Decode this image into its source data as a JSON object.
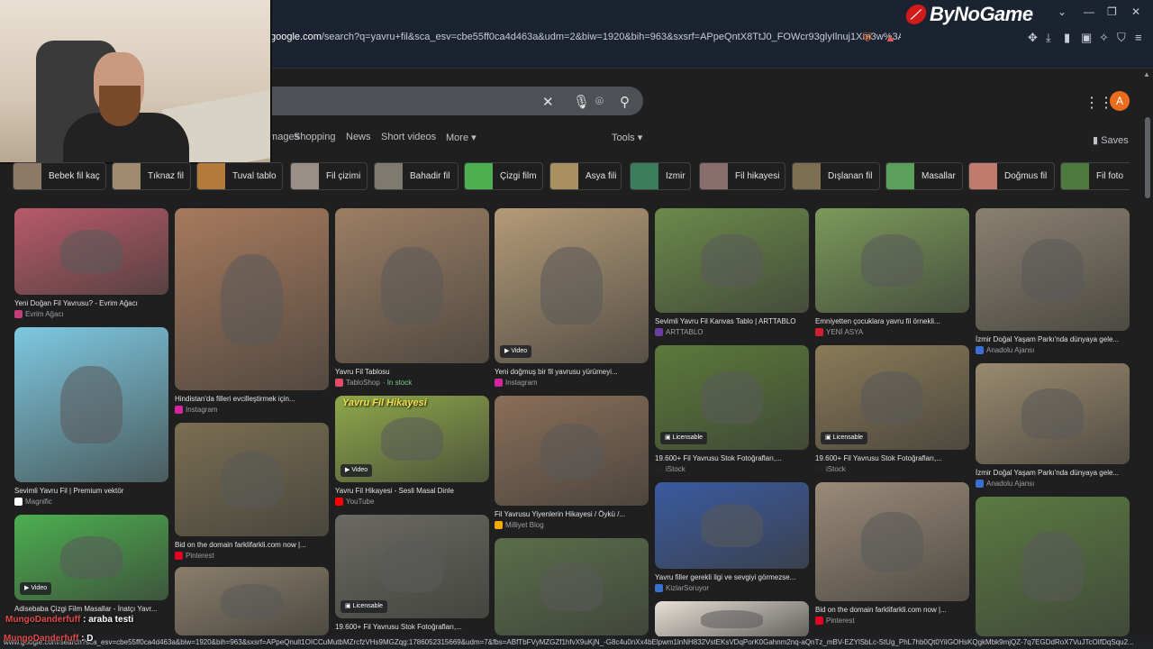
{
  "browser": {
    "url_domain": "google.com",
    "url_rest": "/search?q=yavru+fil&sca_esv=cbe55ff0ca4d463a&udm=2&biw=1920&bih=963&sxsrf=APpeQntX8TtJ0_FOWcr93glyIlnuj1Xm3w%3A1786052...",
    "status_url": "www.google.com/search?sca_esv=cbe55ff0ca4d463a&biw=1920&bih=963&sxsrf=APpeQnult1OICCuMutbMZrcfzVHs9MGZqg:1786052315669&udm=7&fbs=ABfTbFVyMZGZf1hfvX9uKjN_-G8c4u0nXx4bElpwm1lnNH832VstEKsVDqPorK0Gahnm2nq-aQnTz_mBV-EZYlSbLc-StUg_PhL7hb0Qt0YiIGOHsKQgkMbk9mjQZ-7q7EGDdRoX7VuJTcOIfDqSqu2...",
    "brand": "ByNoGame"
  },
  "search": {
    "tabs": [
      "Images",
      "Shopping",
      "News",
      "Short videos",
      "More",
      "Tools"
    ],
    "saves_label": "Saves",
    "avatar_letter": "A"
  },
  "chips": [
    {
      "label": "Bebek fil kaç",
      "color": "#8c7a66"
    },
    {
      "label": "Tıknaz fil",
      "color": "#a08a70"
    },
    {
      "label": "Tuval tablo",
      "color": "#b47a3c"
    },
    {
      "label": "Fil çizimi",
      "color": "#9a8f86"
    },
    {
      "label": "Bahadir fil",
      "color": "#7e7a70"
    },
    {
      "label": "Çizgi film",
      "color": "#4caf50"
    },
    {
      "label": "Asya fili",
      "color": "#a89060"
    },
    {
      "label": "Izmir",
      "color": "#3b7d5a"
    },
    {
      "label": "Fil hikayesi",
      "color": "#8a6e6e"
    },
    {
      "label": "Dışlanan fil",
      "color": "#7e6e52"
    },
    {
      "label": "Masallar",
      "color": "#5aa05a"
    },
    {
      "label": "Doğmus fil",
      "color": "#c07a6e"
    },
    {
      "label": "Fil foto",
      "color": "#4f7a3e"
    }
  ],
  "results": [
    {
      "caption": "Yeni Doğan Fil Yavrusu? - Evrim Ağacı",
      "source": "Evrim Ağacı",
      "color": "#b85a6a",
      "fav": "#c43f7a"
    },
    {
      "caption": "Sevimli Yavru Fil | Premium vektör",
      "source": "Magnific",
      "color": "#7ec8e0",
      "fav": "#ffffff"
    },
    {
      "caption": "Adisebaba Çizgi Film Masallar - İnatçı Yavr...",
      "source": "",
      "color": "#4caf50",
      "fav": "#ff0000",
      "badge": "Video"
    },
    {
      "caption": "Hindistan'da filleri evcilleştirmek için...",
      "source": "Instagram",
      "color": "#a67a5e",
      "fav": "#d6249f"
    },
    {
      "caption": "Bid on the domain farklifarkli.com now |...",
      "source": "Pinterest",
      "color": "#7a6e52",
      "fav": "#e60023"
    },
    {
      "caption": "",
      "source": "",
      "color": "#8a7e6a",
      "fav": "#000000"
    },
    {
      "caption": "Yavru Fil Tablosu",
      "source": "TabloShop",
      "stock": "· In stock",
      "color": "#9c7e64",
      "fav": "#e24b6a"
    },
    {
      "caption": "Yavru Fil Hikayesi - Sesli Masal Dinle",
      "source": "YouTube",
      "color": "#8ea84a",
      "fav": "#ff0000",
      "badge": "Video",
      "title_overlay": "Yavru Fil Hikayesi"
    },
    {
      "caption": "19.600+ Fil Yavrusu Stok Fotoğrafları,...",
      "source": "",
      "color": "#6a6a62",
      "fav": "#000000",
      "badge": "Licensable"
    },
    {
      "caption": "Yeni doğmuş bir fil yavrusu yürümeyi...",
      "source": "Instagram",
      "color": "#b49a78",
      "fav": "#d6249f",
      "badge": "Video"
    },
    {
      "caption": "Fil Yavrusu Yiyenlerin Hikayesi / Öykü /...",
      "source": "Milliyet Blog",
      "color": "#8a6e58",
      "fav": "#f2a900"
    },
    {
      "caption": "",
      "source": "",
      "color": "#5a6e4a",
      "fav": "#000000"
    },
    {
      "caption": "Sevimli Yavru Fil Kanvas Tablo | ARTTABLO",
      "source": "ARTTABLO",
      "color": "#6a8a4a",
      "fav": "#6a3fa0"
    },
    {
      "caption": "19.600+ Fil Yavrusu Stok Fotoğrafları,...",
      "source": "iStock",
      "color": "#5a7a3a",
      "fav": "#222222",
      "badge": "Licensable"
    },
    {
      "caption": "Yavru filler gerekli ilgi ve sevgiyi görmezse...",
      "source": "KizlarSoruyor",
      "color": "#3a5aa0",
      "fav": "#3a6fd0"
    },
    {
      "caption": "",
      "source": "",
      "color": "#e8e0d8",
      "fav": "#000000"
    },
    {
      "caption": "Emniyetten çocuklara yavru fil örnekli...",
      "source": "YENİ ASYA",
      "color": "#7a9a5a",
      "fav": "#d01f2e"
    },
    {
      "caption": "19.600+ Fil Yavrusu Stok Fotoğrafları,...",
      "source": "iStock",
      "color": "#8a7a58",
      "fav": "#222222",
      "badge": "Licensable"
    },
    {
      "caption": "Bid on the domain farklifarkli.com now |...",
      "source": "Pinterest",
      "color": "#9a8a78",
      "fav": "#e60023"
    },
    {
      "caption": "İzmir Doğal Yaşam Parkı'nda dünyaya gele...",
      "source": "Anadolu Ajansı",
      "color": "#8a8070",
      "fav": "#3a6fd0"
    },
    {
      "caption": "İzmir Doğal Yaşam Parkı'nda dünyaya gele...",
      "source": "Anadolu Ajansı",
      "color": "#9a8a6e",
      "fav": "#3a6fd0"
    },
    {
      "caption": "",
      "source": "",
      "color": "#5a7a42",
      "fav": "#000000"
    }
  ],
  "chat": {
    "user": "MungoDanderfuff",
    "message": " : araba testi",
    "user2": "MungoDanderfuff",
    "message2": " : D"
  }
}
